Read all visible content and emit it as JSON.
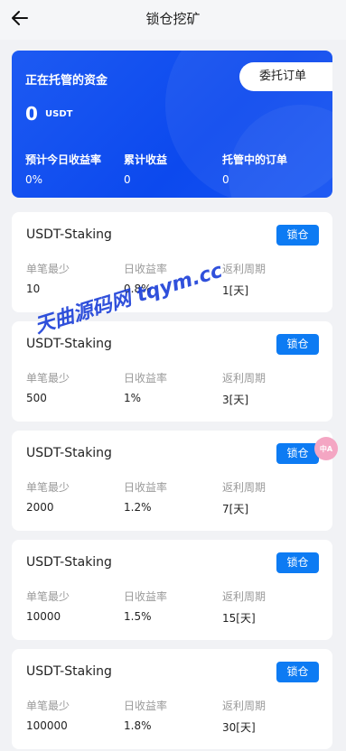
{
  "header": {
    "title": "锁仓挖矿",
    "back_icon": "arrow-left-icon"
  },
  "hero": {
    "label": "正在托管的资金",
    "amount": "0",
    "unit": "USDT",
    "entrust_label": "委托订单",
    "stats": [
      {
        "label": "预计今日收益率",
        "value": "0%"
      },
      {
        "label": "累计收益",
        "value": "0"
      },
      {
        "label": "托管中的订单",
        "value": "0"
      }
    ]
  },
  "card_labels": {
    "min": "单笔最少",
    "rate": "日收益率",
    "period": "返利周期"
  },
  "products": [
    {
      "name": "USDT-Staking",
      "button": "锁仓",
      "min": "10",
      "rate": "0.8%",
      "period": "1[天]"
    },
    {
      "name": "USDT-Staking",
      "button": "锁仓",
      "min": "500",
      "rate": "1%",
      "period": "3[天]"
    },
    {
      "name": "USDT-Staking",
      "button": "锁仓",
      "min": "2000",
      "rate": "1.2%",
      "period": "7[天]"
    },
    {
      "name": "USDT-Staking",
      "button": "锁仓",
      "min": "10000",
      "rate": "1.5%",
      "period": "15[天]"
    },
    {
      "name": "USDT-Staking",
      "button": "锁仓",
      "min": "100000",
      "rate": "1.8%",
      "period": "30[天]"
    }
  ],
  "watermark": "天曲源码网 tqym.cc",
  "floating_badge": "中A",
  "colors": {
    "primary": "#1453f3",
    "button": "#0d7bf3",
    "background": "#f1f2f5"
  }
}
